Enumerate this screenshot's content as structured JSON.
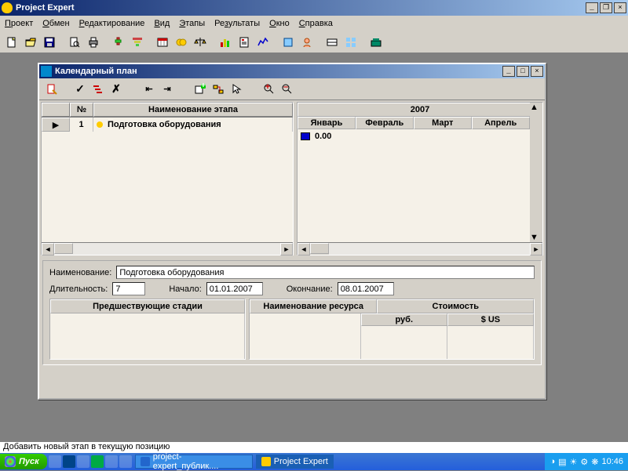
{
  "app": {
    "title": "Project Expert"
  },
  "menu": [
    "Проект",
    "Обмен",
    "Редактирование",
    "Вид",
    "Этапы",
    "Результаты",
    "Окно",
    "Справка"
  ],
  "child": {
    "title": "Календарный план",
    "grid_headers": {
      "num": "№",
      "name": "Наименование этапа"
    },
    "rows": [
      {
        "num": "1",
        "name": "Подготовка оборудования"
      }
    ],
    "year": "2007",
    "months": [
      "Январь",
      "Февраль",
      "Март",
      "Апрель"
    ],
    "gantt": [
      {
        "value": "0.00"
      }
    ],
    "detail": {
      "name_label": "Наименование:",
      "name_value": "Подготовка оборудования",
      "dur_label": "Длительность:",
      "dur_value": "7",
      "start_label": "Начало:",
      "start_value": "01.01.2007",
      "end_label": "Окончание:",
      "end_value": "08.01.2007",
      "prev_stages": "Предшествующие стадии",
      "resource_name": "Наименование ресурса",
      "cost": "Стоимость",
      "rub": "руб.",
      "usd": "$ US"
    }
  },
  "status": "Добавить новый этап в текущую позицию",
  "taskbar": {
    "start": "Пуск",
    "tasks": [
      "project-expert_публик....",
      "Project Expert"
    ],
    "time": "10:46"
  }
}
